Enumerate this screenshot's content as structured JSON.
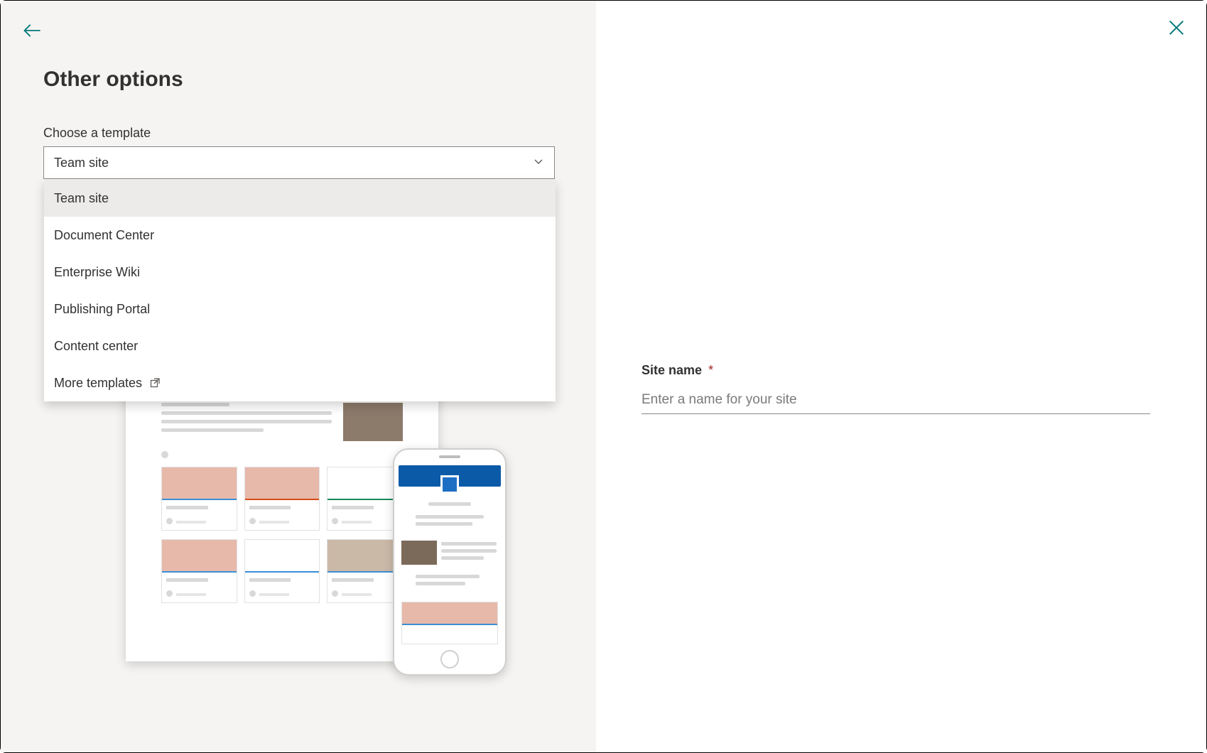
{
  "header": {
    "title": "Other options"
  },
  "template_field": {
    "label": "Choose a template",
    "selected": "Team site",
    "options": [
      "Team site",
      "Document Center",
      "Enterprise Wiki",
      "Publishing Portal",
      "Content center",
      "More templates"
    ]
  },
  "site_name_field": {
    "label": "Site name",
    "required_marker": "*",
    "placeholder": "Enter a name for your site",
    "value": ""
  }
}
